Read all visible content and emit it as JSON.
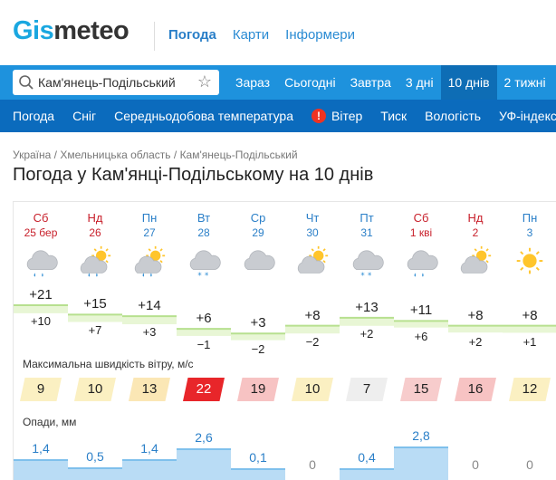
{
  "logo": {
    "part1": "Gis",
    "part2": "meteo"
  },
  "topnav": [
    {
      "label": "Погода",
      "active": true
    },
    {
      "label": "Карти",
      "active": false
    },
    {
      "label": "Інформери",
      "active": false
    }
  ],
  "search": {
    "value": "Кам'янець-Подільський",
    "star": "☆"
  },
  "tabs": [
    {
      "label": "Зараз",
      "active": false
    },
    {
      "label": "Сьогодні",
      "active": false
    },
    {
      "label": "Завтра",
      "active": false
    },
    {
      "label": "3 дні",
      "active": false
    },
    {
      "label": "10 днів",
      "active": true
    },
    {
      "label": "2 тижні",
      "active": false
    }
  ],
  "subnav": [
    {
      "label": "Погода",
      "warn": false
    },
    {
      "label": "Сніг",
      "warn": false
    },
    {
      "label": "Середньодобова температура",
      "warn": false
    },
    {
      "label": "Вітер",
      "warn": true
    },
    {
      "label": "Тиск",
      "warn": false
    },
    {
      "label": "Вологість",
      "warn": false
    },
    {
      "label": "УФ-індекс",
      "warn": false
    }
  ],
  "breadcrumbs": {
    "a": "Україна",
    "sep": " / ",
    "b": "Хмельницька область",
    "c": "Кам'янець-Подільський"
  },
  "title": "Погода у Кам'янці-Подільському на 10 днів",
  "days": [
    {
      "name": "Сб",
      "date": "25 бер",
      "weekend": true,
      "icon": "cloud-rain-icon",
      "max": "+21",
      "min": "+10",
      "wind": "9",
      "windColor": "#fbf0c2",
      "precip": "1,4"
    },
    {
      "name": "Нд",
      "date": "26",
      "weekend": true,
      "icon": "sun-cloud-rain-icon",
      "max": "+15",
      "min": "+7",
      "wind": "10",
      "windColor": "#fbf0c2",
      "precip": "0,5"
    },
    {
      "name": "Пн",
      "date": "27",
      "weekend": false,
      "icon": "sun-cloud-rain-icon",
      "max": "+14",
      "min": "+3",
      "wind": "13",
      "windColor": "#fbe7b5",
      "precip": "1,4"
    },
    {
      "name": "Вт",
      "date": "28",
      "weekend": false,
      "icon": "cloud-snow-icon",
      "max": "+6",
      "min": "−1",
      "wind": "22",
      "windColor": "#e8262a",
      "precip": "2,6"
    },
    {
      "name": "Ср",
      "date": "29",
      "weekend": false,
      "icon": "cloud-icon",
      "max": "+3",
      "min": "−2",
      "wind": "19",
      "windColor": "#f7c3c3",
      "precip": "0,1"
    },
    {
      "name": "Чт",
      "date": "30",
      "weekend": false,
      "icon": "sun-cloud-icon",
      "max": "+8",
      "min": "−2",
      "wind": "10",
      "windColor": "#fbf0c2",
      "precip": "0"
    },
    {
      "name": "Пт",
      "date": "31",
      "weekend": false,
      "icon": "cloud-snow-icon",
      "max": "+13",
      "min": "+2",
      "wind": "7",
      "windColor": "#eeeeee",
      "precip": "0,4"
    },
    {
      "name": "Сб",
      "date": "1 кві",
      "weekend": true,
      "icon": "cloud-rain-icon",
      "max": "+11",
      "min": "+6",
      "wind": "15",
      "windColor": "#f7cccc",
      "precip": "2,8"
    },
    {
      "name": "Нд",
      "date": "2",
      "weekend": true,
      "icon": "sun-cloud-icon",
      "max": "+8",
      "min": "+2",
      "wind": "16",
      "windColor": "#f7c3c3",
      "precip": "0"
    },
    {
      "name": "Пн",
      "date": "3",
      "weekend": false,
      "icon": "sun-icon",
      "max": "+8",
      "min": "+1",
      "wind": "12",
      "windColor": "#fbf0c2",
      "precip": "0"
    }
  ],
  "wind_title": "Максимальна швидкість вітру, м/с",
  "precip_title": "Опади, мм"
}
